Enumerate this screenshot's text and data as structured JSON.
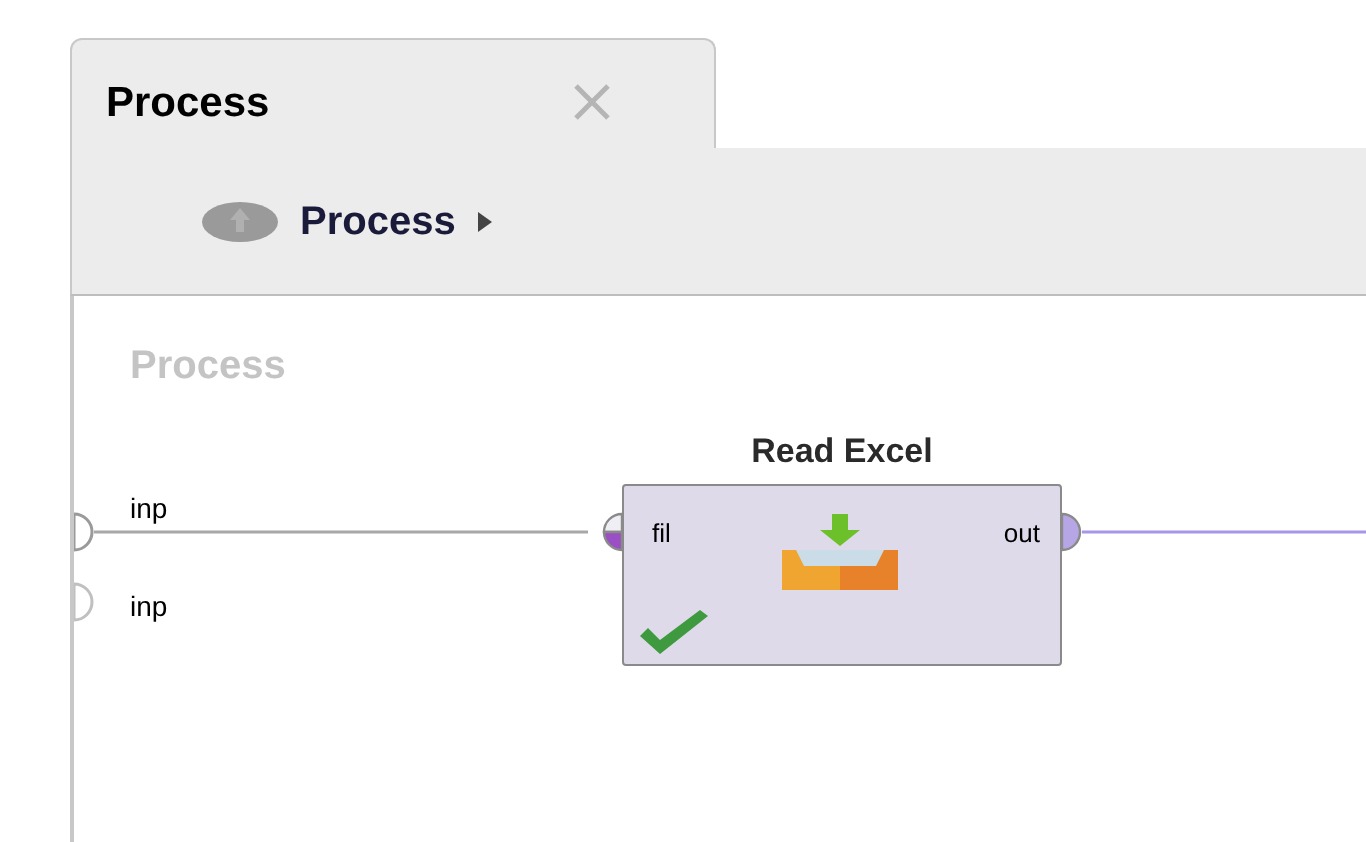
{
  "tabs": [
    {
      "label": "Process",
      "selected": true
    }
  ],
  "breadcrumb": {
    "label": "Process"
  },
  "canvas": {
    "label": "Process",
    "process_inputs": [
      {
        "label": "inp",
        "connected": true
      },
      {
        "label": "inp",
        "connected": false
      }
    ],
    "operator": {
      "name": "Read Excel",
      "input_port": {
        "label": "fil",
        "connected": true
      },
      "output_port": {
        "label": "out",
        "connected": true
      },
      "ready": true
    }
  }
}
